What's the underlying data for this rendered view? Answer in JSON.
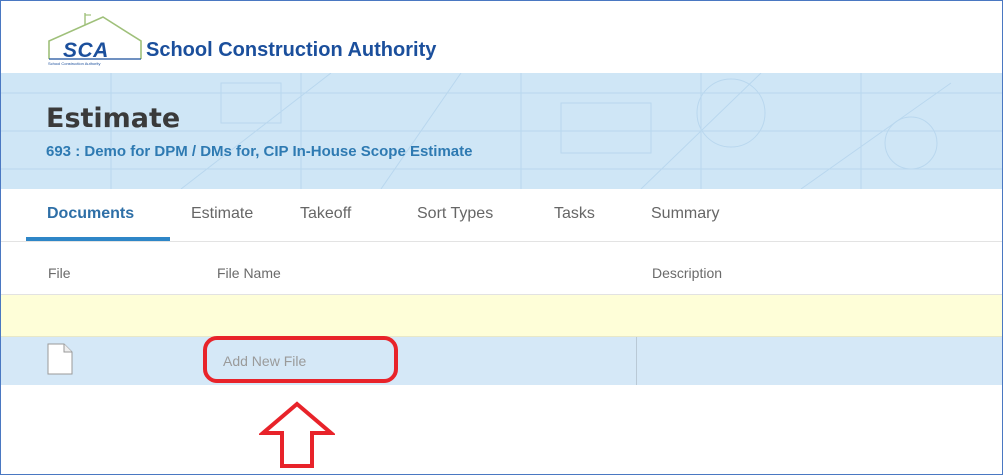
{
  "brand": {
    "abbr": "SCA",
    "name": "School Construction Authority",
    "sub": "School Construction Authority"
  },
  "header": {
    "title": "Estimate",
    "subtitle": "693 : Demo for DPM / DMs for, CIP In-House Scope Estimate"
  },
  "tabs": [
    {
      "label": "Documents",
      "active": true
    },
    {
      "label": "Estimate",
      "active": false
    },
    {
      "label": "Takeoff",
      "active": false
    },
    {
      "label": "Sort Types",
      "active": false
    },
    {
      "label": "Tasks",
      "active": false
    },
    {
      "label": "Summary",
      "active": false
    }
  ],
  "table": {
    "columns": [
      "File",
      "File Name",
      "Description"
    ],
    "new_file_placeholder": "Add New File"
  },
  "colors": {
    "brand_blue": "#1b4f9c",
    "header_bg": "#cfe6f6",
    "tab_active": "#2e6fa7",
    "row_highlight": "#fefed8",
    "row_selected": "#d5e8f7",
    "annotation_red": "#e8232a"
  },
  "icons": {
    "logo": "house-outline-icon",
    "file": "blank-document-icon",
    "annotation_arrow": "up-arrow-outline-icon"
  }
}
